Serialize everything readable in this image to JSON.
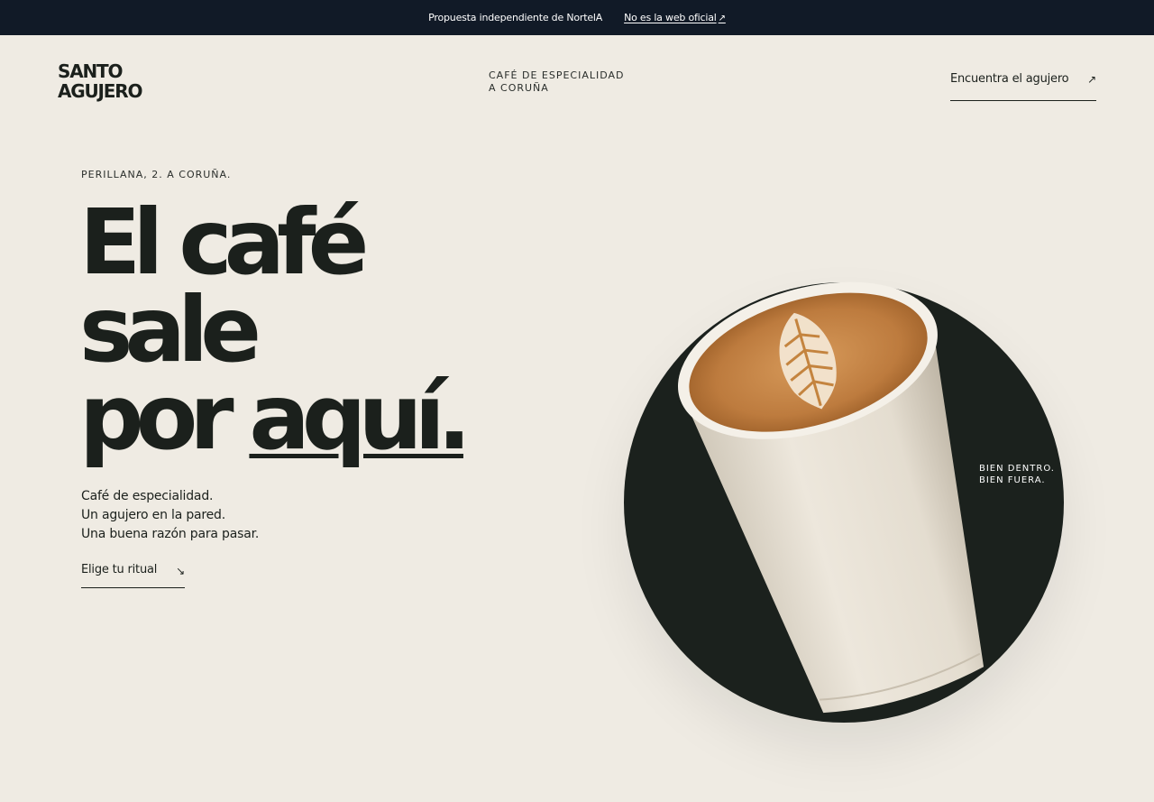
{
  "banner": {
    "text": "Propuesta independiente de NortelA",
    "link_label": "No es la web oficial",
    "link_arrow": "↗"
  },
  "header": {
    "logo_line1": "SANTO",
    "logo_line2": "AGUJERO",
    "tagline_line1": "CAFÉ DE ESPECIALIDAD",
    "tagline_line2": "A CORUÑA",
    "find_label": "Encuentra el agujero",
    "find_arrow": "↗"
  },
  "hero": {
    "address": "PERILLANA, 2. A CORUÑA.",
    "headline_line1": "El café",
    "headline_line2": "sale",
    "headline_line3_a": "por ",
    "headline_line3_b": "aquí.",
    "desc_line1": "Café de especialidad.",
    "desc_line2": "Un agujero en la pared.",
    "desc_line3": "Una buena razón para pasar.",
    "cta_label": "Elige tu ritual",
    "cta_arrow": "↘"
  },
  "visual": {
    "circle_text_line1": "BIEN DENTRO.",
    "circle_text_line2": "BIEN FUERA.",
    "image": "latte-cup-illustration"
  },
  "colors": {
    "background": "#efebe3",
    "banner": "#111a27",
    "ink": "#1b201c",
    "circle": "#1b211d",
    "coffee": "#b8773b"
  }
}
